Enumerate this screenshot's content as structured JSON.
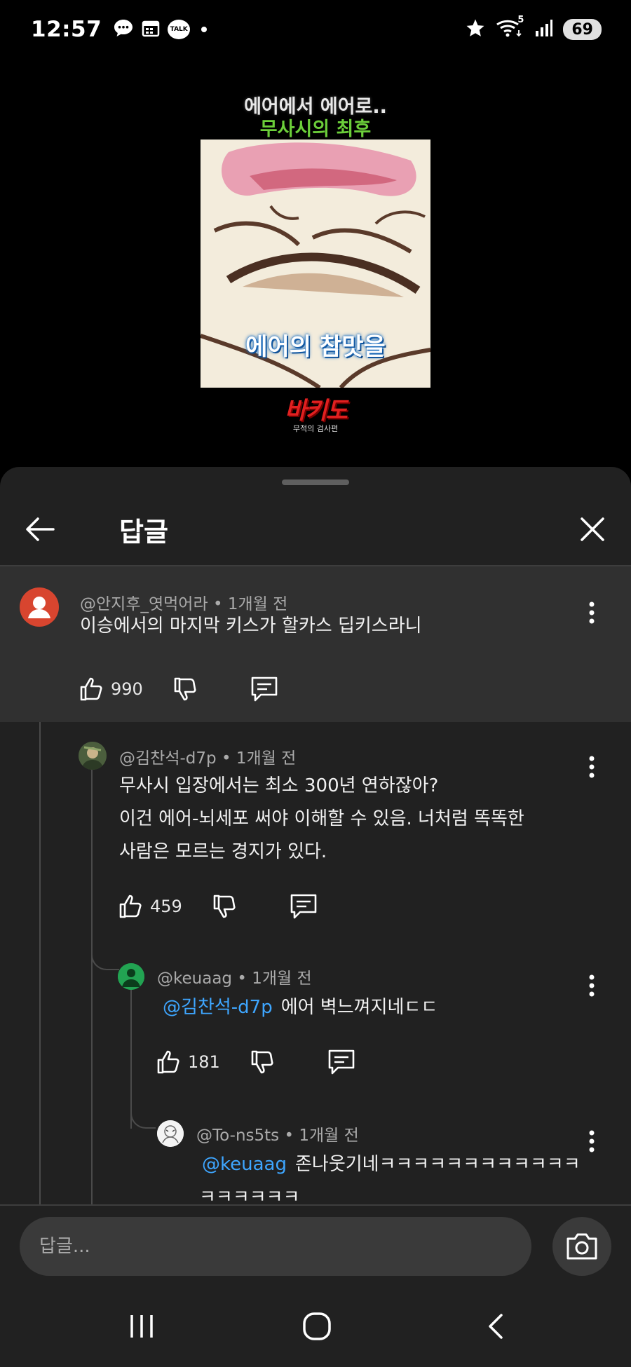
{
  "status_bar": {
    "time": "12:57",
    "battery": "69",
    "notification_icons": [
      "chat-bubble-icon",
      "calendar-icon",
      "kakaotalk-icon",
      "dot-icon"
    ],
    "kakaotalk_label": "TALK",
    "wifi_badge": "5"
  },
  "video": {
    "caption_line1": "에어에서 에어로..",
    "caption_line2": "무사시의 최후",
    "overlay_text": "에어의 참맛을",
    "logo_main": "바키도",
    "logo_sub": "무적의 검사편",
    "accent_green": "#6ccf3a"
  },
  "sheet": {
    "title": "답글"
  },
  "comments": [
    {
      "author": "@안지후_엿먹어라",
      "time": "1개월 전",
      "text": "이승에서의 마지막 키스가 할카스 딥키스라니",
      "likes": "990",
      "avatar_color": "#d8452f"
    },
    {
      "author": "@김찬석-d7p",
      "time": "1개월 전",
      "text_lines": [
        "무사시 입장에서는 최소 300년 연하잖아?",
        "이건 에어-뇌세포 써야 이해할 수 있음. 너처럼 똑똑한",
        "사람은 모르는 경지가 있다."
      ],
      "likes": "459"
    },
    {
      "author": "@keuaag",
      "time": "1개월 전",
      "mention": "@김찬석-d7p",
      "text": "에어 벽느껴지네ㄷㄷ",
      "likes": "181"
    },
    {
      "author": "@To-ns5ts",
      "time": "1개월 전",
      "mention": "@keuaag",
      "text_line1": "존나웃기네ㅋㅋㅋㅋㅋㅋㅋㅋㅋㅋㅋㅋ",
      "text_line2": "ㅋㅋㅋㅋㅋㅋ"
    }
  ],
  "separator": "•",
  "reply_input": {
    "placeholder": "답글..."
  },
  "colors": {
    "sheet_bg": "#212121",
    "highlight_bg": "#303030",
    "mention": "#3ea6ff"
  }
}
